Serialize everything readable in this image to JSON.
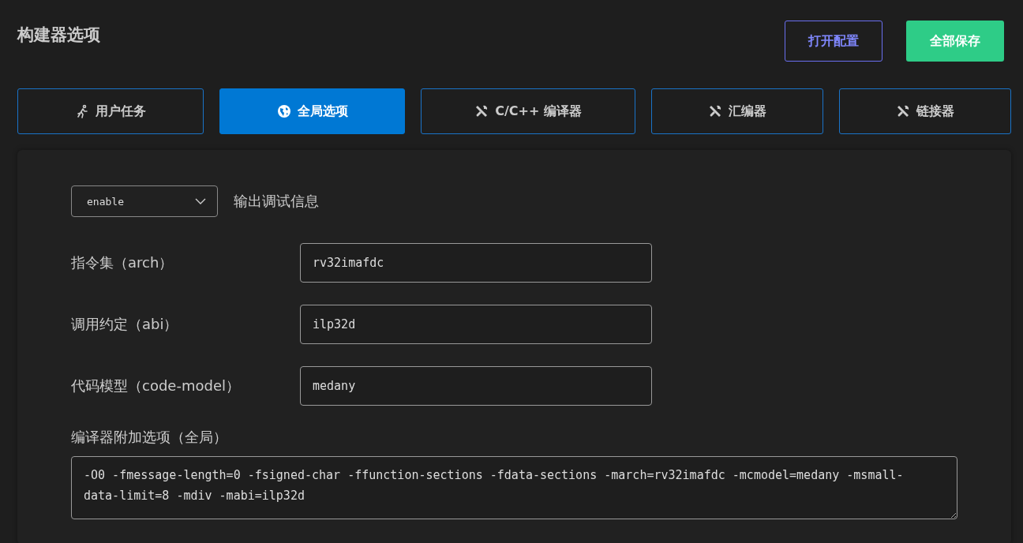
{
  "title": "构建器选项",
  "buttons": [
    {
      "label": "打开配置",
      "kind": "outline"
    },
    {
      "label": "全部保存",
      "kind": "primary"
    }
  ],
  "tabs": [
    {
      "label": "用户任务",
      "kind": "run",
      "selected": false
    },
    {
      "label": "全局选项",
      "kind": "globe",
      "selected": true
    },
    {
      "label": "C/C++ 编译器",
      "kind": "tools",
      "selected": false
    },
    {
      "label": "汇编器",
      "kind": "tools",
      "selected": false
    },
    {
      "label": "链接器",
      "kind": "tools",
      "selected": false
    }
  ],
  "debug": {
    "value": "enable",
    "label": "输出调试信息"
  },
  "fields": [
    {
      "label": "指令集（arch）",
      "value": "rv32imafdc"
    },
    {
      "label": "调用约定（abi）",
      "value": "ilp32d"
    },
    {
      "label": "代码模型（code-model）",
      "value": "medany"
    }
  ],
  "extra": {
    "label": "编译器附加选项（全局）",
    "value": "-O0 -fmessage-length=0 -fsigned-char -ffunction-sections -fdata-sections -march=rv32imafdc -mcmodel=medany -msmall-data-limit=8 -mdiv -mabi=ilp32d"
  }
}
